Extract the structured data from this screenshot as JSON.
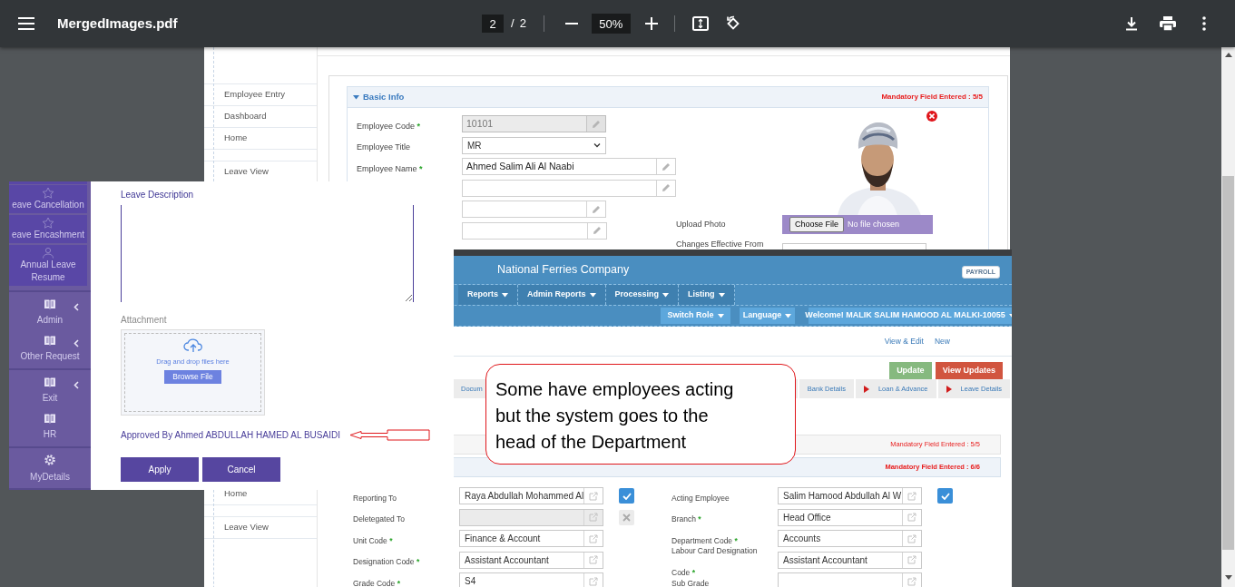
{
  "viewer": {
    "title": "MergedImages.pdf",
    "page": "2",
    "page_separator": "/",
    "page_count": "2",
    "zoom": "50%"
  },
  "employee_entry": {
    "sidebar_groups": [
      [
        "Employee Entry",
        "Dashboard",
        "Home"
      ],
      [
        "Leave View"
      ]
    ],
    "section": {
      "title": "Basic Info",
      "expanded": true,
      "mandatory_status": "Mandatory Field Entered : 5/5"
    },
    "fields": [
      {
        "label": "Employee Code",
        "mark": "*",
        "kind": "text",
        "value": "10101",
        "disabled": true
      },
      {
        "label": "Employee Title",
        "kind": "select",
        "value": "MR"
      },
      {
        "label": "Employee Name",
        "mark": "*",
        "kind": "text",
        "value": "Ahmed Salim Ali Al Naabi",
        "disabled": false
      },
      {
        "kind": "text",
        "disabled": false
      },
      {
        "kind": "text",
        "disabled": false
      },
      {
        "kind": "text",
        "disabled": false
      }
    ],
    "upload_photo": {
      "label": "Upload Photo",
      "button": "Choose File",
      "status": "No file chosen"
    },
    "effective_date": {
      "label": "Changes Effective From"
    }
  },
  "leave_form": {
    "sidebar_tiles": [
      "eave Cancellation",
      "eave Encashment",
      "Annual Leave Resume"
    ],
    "menu_groups": [
      [
        {
          "label": "Admin",
          "submenu": true
        },
        {
          "label": "Other Request",
          "submenu": true
        }
      ],
      [
        {
          "label": "Exit",
          "submenu": true
        },
        {
          "label": "HR",
          "submenu": false
        }
      ],
      [
        {
          "label": "MyDetails",
          "submenu": false
        }
      ]
    ],
    "description_label": "Leave Description",
    "attachment_label": "Attachment",
    "drop_text": "Drag and drop files here",
    "browse_button": "Browse File",
    "approved_by": "Approved By Ahmed ABDULLAH HAMED AL BUSAIDI",
    "buttons": [
      "Apply",
      "Cancel"
    ]
  },
  "callout": {
    "text": "Some have employees acting but the system goes to the head of the Department"
  },
  "payroll": {
    "company": "National Ferries Company",
    "badge": "PAYROLL",
    "menu": [
      "Reports",
      "Admin Reports",
      "Processing",
      "Listing"
    ],
    "user_menu": [
      "Switch Role",
      "Language",
      "Welcome! MALIK SALIM HAMOOD AL MALKI-10055"
    ],
    "links": [
      "View & Edit",
      "New"
    ],
    "actions": [
      {
        "label": "Update",
        "kind": "success"
      },
      {
        "label": "View Updates",
        "kind": "danger"
      }
    ],
    "tabs_left": [
      {
        "label": "Docum",
        "arrow": false
      }
    ],
    "tabs_right": [
      {
        "label": "Bank Details",
        "arrow": false
      },
      {
        "label": "Loan & Advance",
        "arrow": true
      },
      {
        "label": "Leave Details",
        "arrow": true
      }
    ],
    "sidebar_groups": [
      [
        "Home"
      ],
      [
        "Leave View"
      ]
    ],
    "panel_status": [
      "Mandatory Field Entered : 5/5",
      "Mandatory Field Entered : 6/6"
    ],
    "rows": [
      [
        {
          "label": "Reporting To",
          "value": "Raya Abdullah Mohammed Al",
          "disabled": false,
          "checked": true
        },
        {
          "label": "Acting Employee",
          "value": "Salim Hamood Abdullah Al W",
          "disabled": false,
          "checked": true
        }
      ],
      [
        {
          "label": "Deletegated To",
          "disabled": true,
          "checked": false
        },
        {
          "label": "Branch",
          "mark": "*",
          "value": "Head Office",
          "disabled": false
        }
      ],
      [
        {
          "label": "Unit Code",
          "mark": "*",
          "value": "Finance & Account",
          "disabled": false
        },
        {
          "label": "Department Code",
          "mark": "*",
          "value": "Accounts",
          "disabled": false
        }
      ],
      [
        {
          "label": "Designation Code",
          "mark": "*",
          "value": "Assistant Accountant",
          "disabled": false
        },
        {
          "label": "Labour Card Designation Code",
          "mark": "*",
          "value": "Assistant Accountant",
          "disabled": false
        }
      ],
      [
        {
          "label": "Grade Code",
          "mark": "*",
          "value": "S4",
          "disabled": false
        },
        {
          "label": "Sub Grade",
          "disabled": false
        }
      ]
    ]
  }
}
